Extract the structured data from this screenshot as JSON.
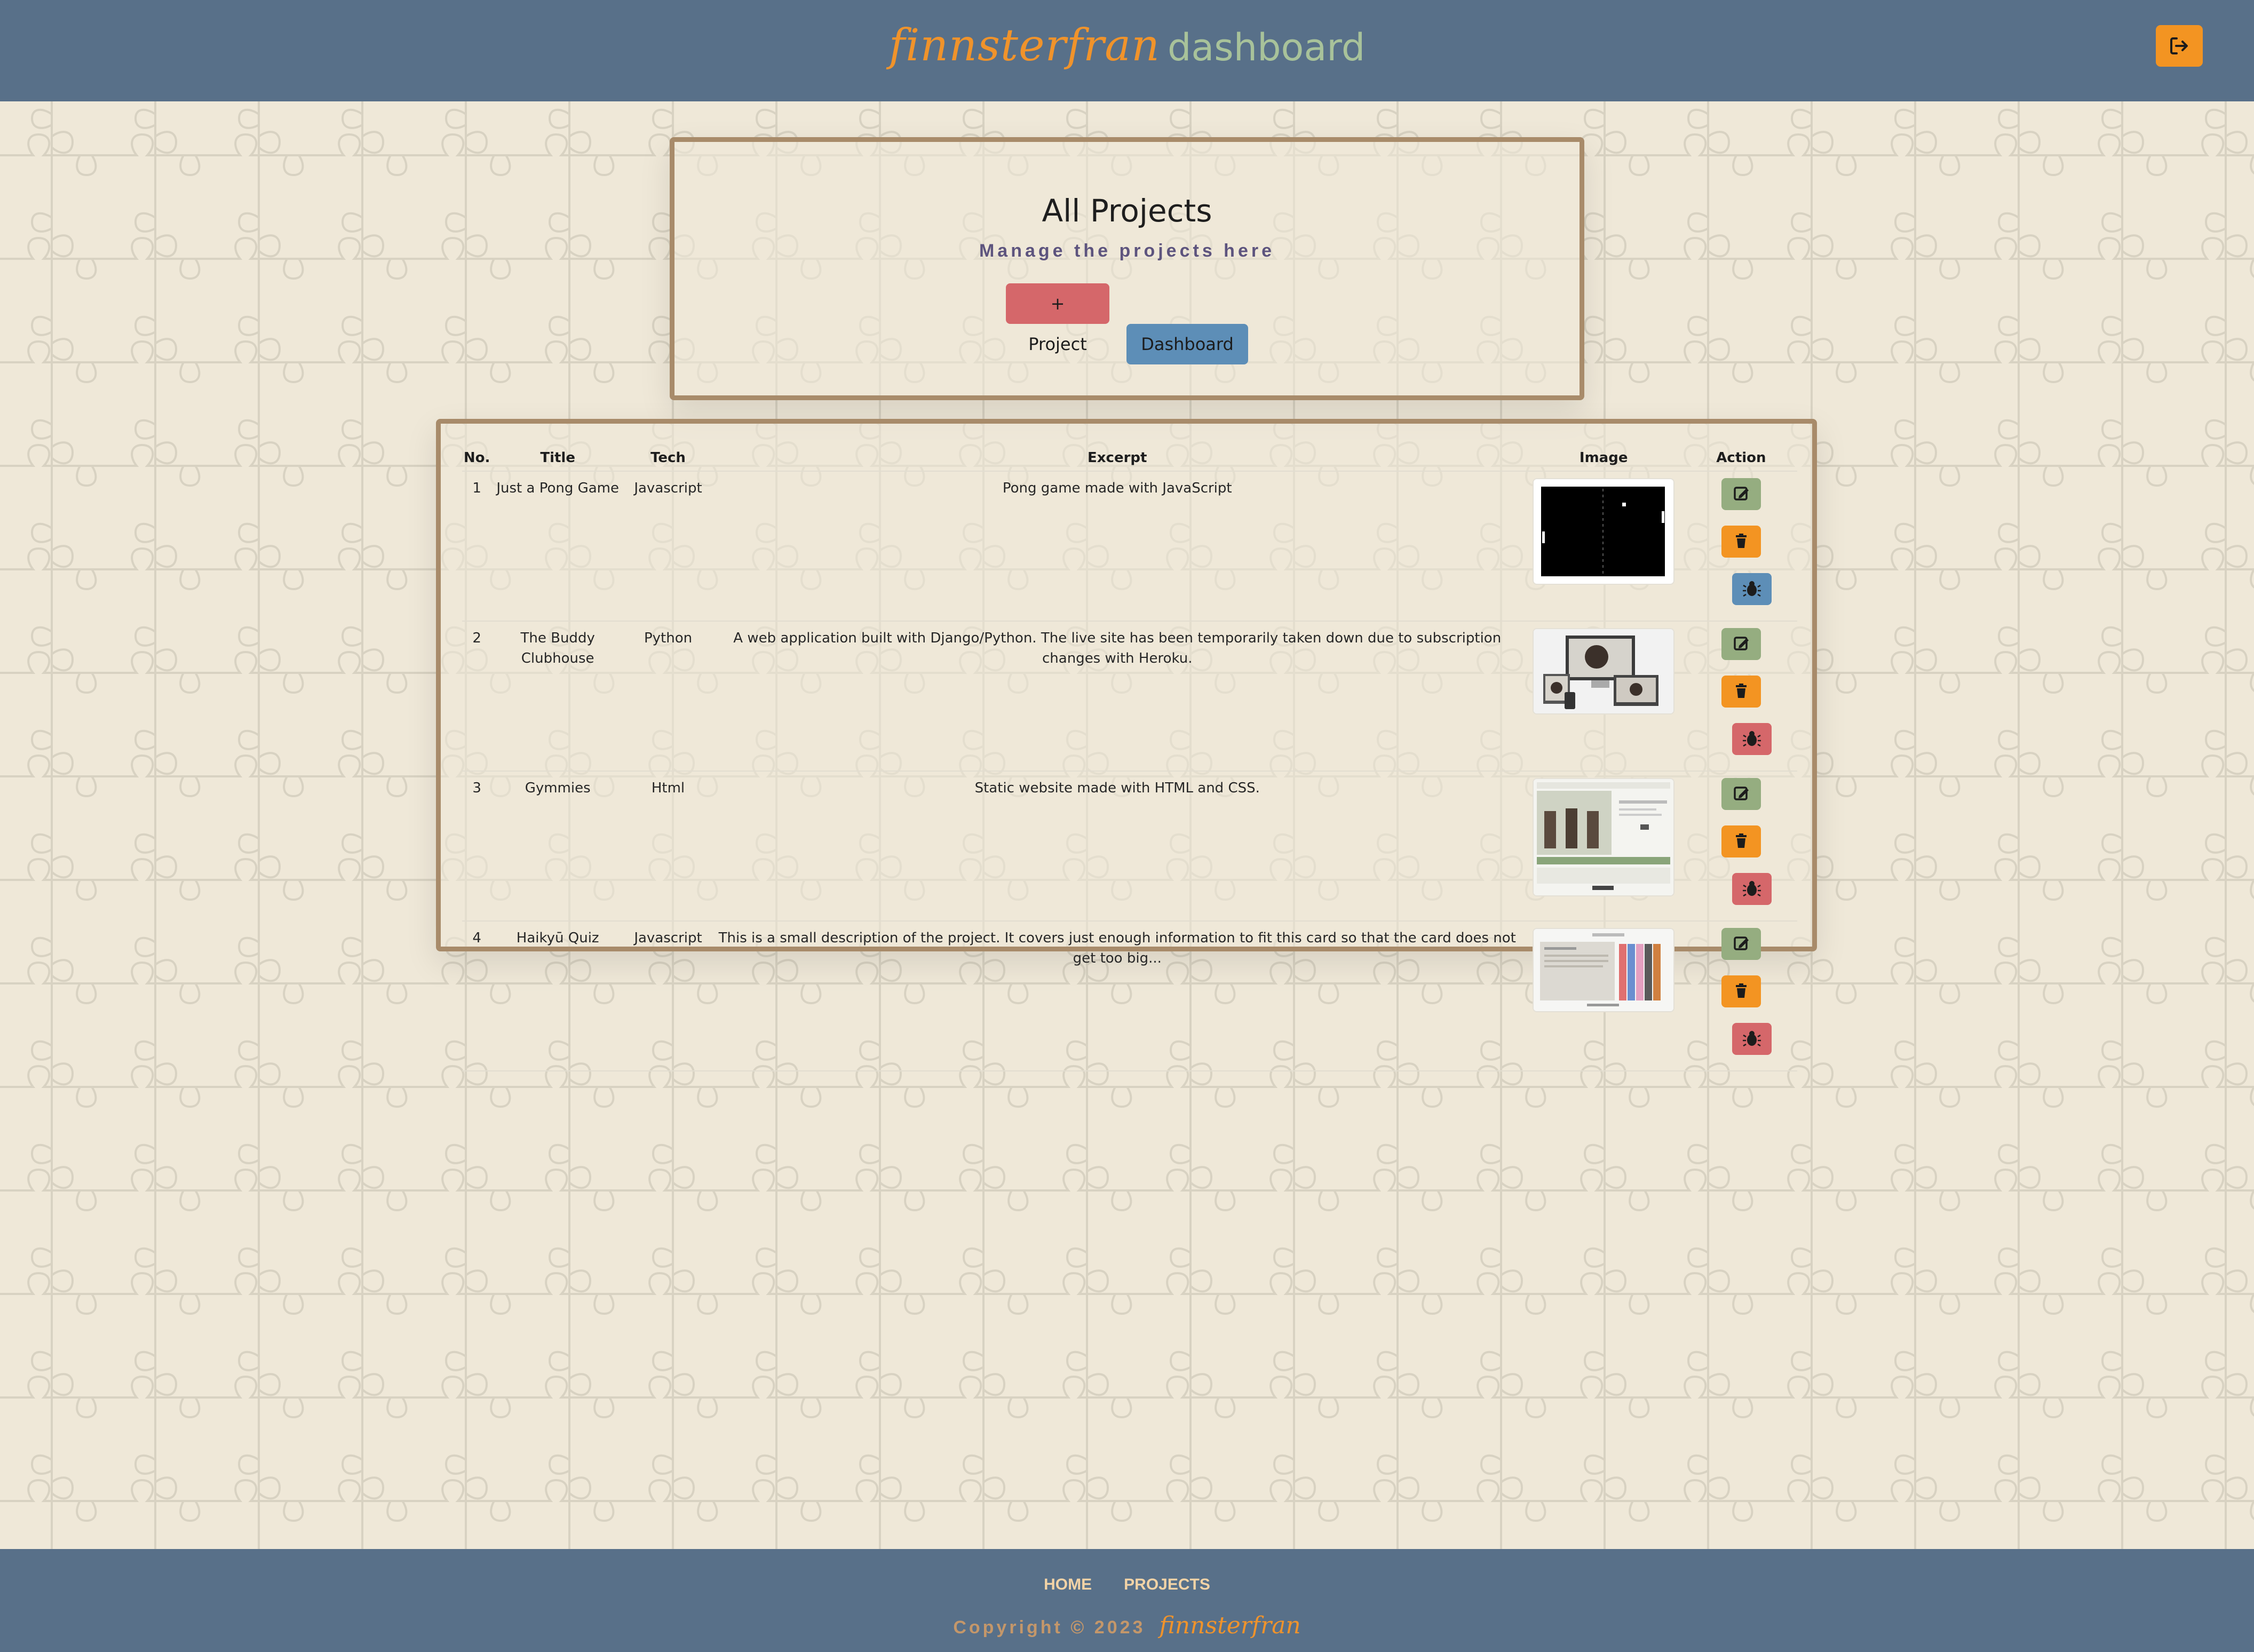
{
  "brand": {
    "script": "finnsterfran",
    "word": "dashboard"
  },
  "header": {
    "logout_icon": "sign-out-icon"
  },
  "hero": {
    "title": "All Projects",
    "subtitle": "Manage the projects here",
    "add_button": "+ Project",
    "dashboard_button": "Dashboard"
  },
  "table": {
    "headers": [
      "No.",
      "Title",
      "Tech",
      "Excerpt",
      "Image",
      "Action"
    ],
    "rows": [
      {
        "no": "1",
        "title": "Just a Pong Game",
        "tech": "Javascript",
        "excerpt": "Pong game made with JavaScript",
        "image": "pong-screenshot",
        "publish_state": "blue"
      },
      {
        "no": "2",
        "title": "The Buddy Clubhouse",
        "tech": "Python",
        "excerpt": "A web application built with Django/Python. The live site has been temporarily taken down due to subscription changes with Heroku.",
        "image": "buddy-clubhouse-devices",
        "publish_state": "red"
      },
      {
        "no": "3",
        "title": "Gymmies",
        "tech": "Html",
        "excerpt": "Static website made with HTML and CSS.",
        "image": "gymmies-site",
        "publish_state": "red"
      },
      {
        "no": "4",
        "title": "Haikyū Quiz",
        "tech": "Javascript",
        "excerpt": "This is a small description of the project. It covers just enough information to fit this card so that the card does not get too big...",
        "image": "haikyu-quiz-site",
        "publish_state": "red"
      }
    ]
  },
  "footer": {
    "links": [
      "HOME",
      "PROJECTS"
    ],
    "copyright": "Copyright © 2023",
    "brand": "finnsterfran"
  },
  "colors": {
    "navbar": "#587089",
    "background": "#efe8d8",
    "accent_orange": "#f39422",
    "edit_green": "#95ad80",
    "add_red": "#d5676a",
    "dash_blue": "#5d8eb7",
    "panel_border": "#a88b6a"
  }
}
